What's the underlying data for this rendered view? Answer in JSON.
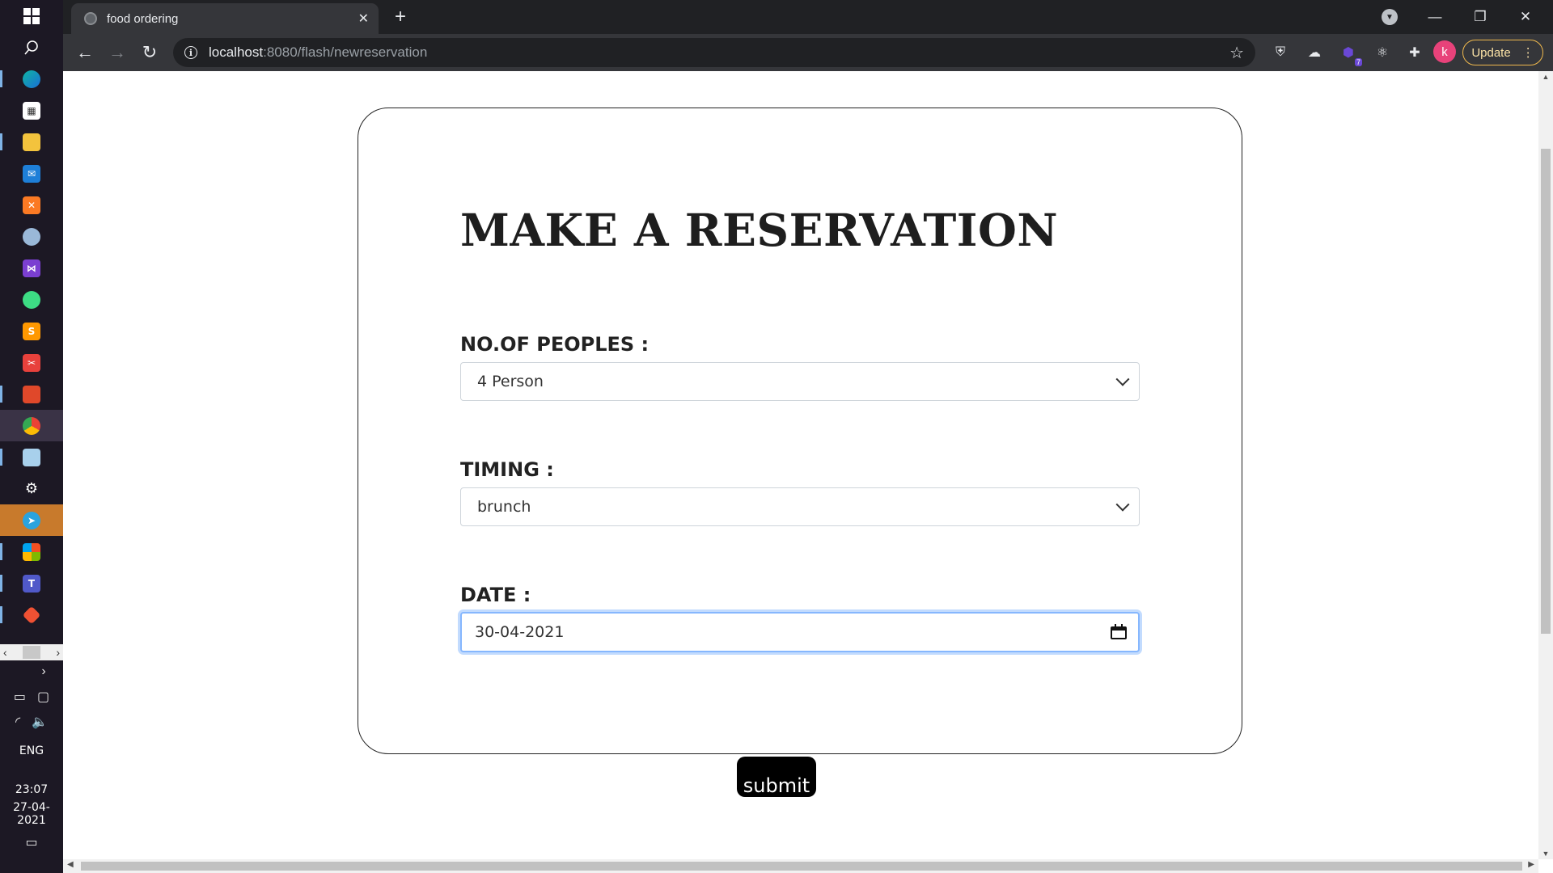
{
  "taskbar": {
    "clock_time": "23:07",
    "clock_date": "27-04-2021",
    "language": "ENG"
  },
  "browser": {
    "tab_title": "food ordering",
    "url_host": "localhost",
    "url_path": ":8080/flash/newreservation",
    "profile_initial": "k",
    "update_label": "Update",
    "extension_badge": "7"
  },
  "page": {
    "heading": "MAKE A RESERVATION",
    "people_label": "NO.OF PEOPLES :",
    "people_value": "4 Person",
    "timing_label": "TIMING :",
    "timing_value": "brunch",
    "date_label": "DATE :",
    "date_value": "30-04-2021",
    "submit_label": "submit"
  }
}
